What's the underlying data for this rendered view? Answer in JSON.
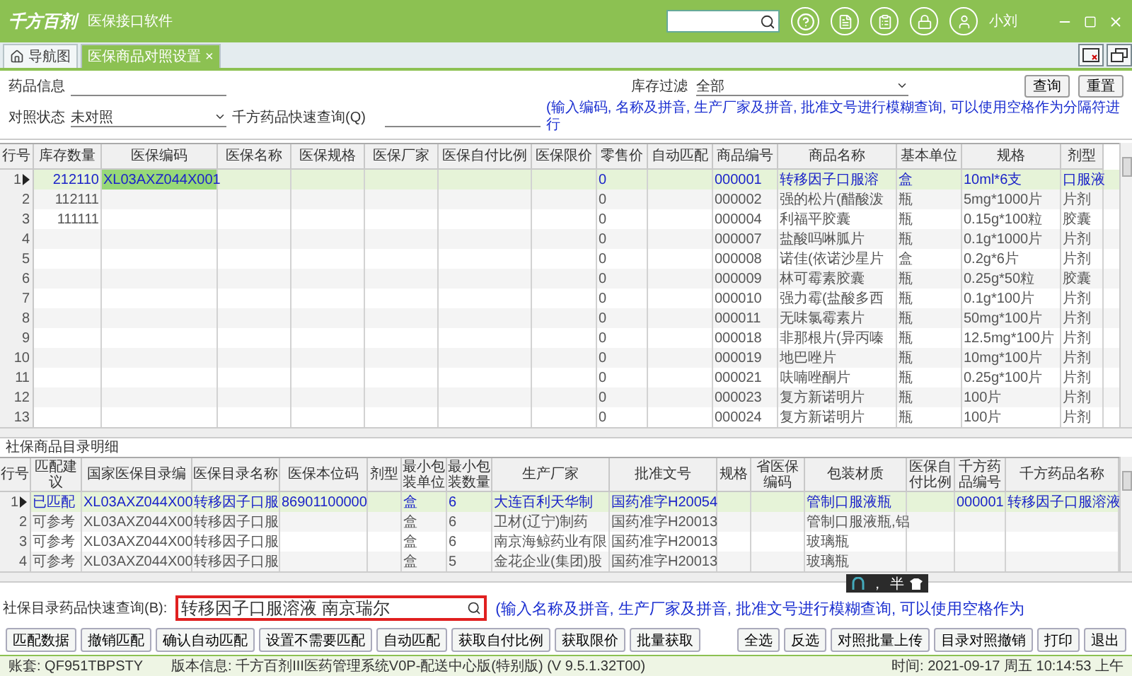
{
  "app": {
    "logo": "千方百剂",
    "title": "医保接口软件",
    "user": "小刘"
  },
  "tabs": [
    {
      "label": "导航图",
      "selected": false,
      "home": true
    },
    {
      "label": "医保商品对照设置",
      "selected": true,
      "close": "×"
    }
  ],
  "filters": {
    "drug_info": {
      "label": "药品信息"
    },
    "match_status": {
      "label": "对照状态",
      "value": "未对照"
    },
    "quick_query": {
      "label": "千方药品快速查询(Q)"
    },
    "stock_filter": {
      "label": "库存过滤",
      "value": "全部"
    },
    "buttons": [
      "查询",
      "重置"
    ],
    "hint": "(输入编码, 名称及拼音, 生产厂家及拼音, 批准文号进行模糊查询, 可以使用空格作为分隔符进行"
  },
  "goods_table": {
    "columns": [
      "行号",
      "库存数量",
      "医保编码",
      "医保名称",
      "医保规格",
      "医保厂家",
      "医保自付比例",
      "医保限价",
      "零售价",
      "自动匹配",
      "商品编号",
      "商品名称",
      "基本单位",
      "规格",
      "剂型"
    ],
    "rows": [
      {
        "selected": true,
        "cells": [
          "1",
          "212110",
          {
            "text": "XL03AXZ044X001",
            "active": true
          },
          "",
          "",
          "",
          "",
          "",
          "0",
          "",
          "000001",
          "转移因子口服溶",
          "盒",
          "10ml*6支",
          "口服液"
        ]
      },
      {
        "selected": false,
        "cells": [
          "2",
          "112111",
          "",
          "",
          "",
          "",
          "",
          "",
          "0",
          "",
          "000002",
          "强的松片(醋酸泼",
          "瓶",
          "5mg*1000片",
          "片剂"
        ]
      },
      {
        "selected": false,
        "cells": [
          "3",
          "111111",
          "",
          "",
          "",
          "",
          "",
          "",
          "0",
          "",
          "000004",
          "利福平胶囊",
          "瓶",
          "0.15g*100粒",
          "胶囊"
        ]
      },
      {
        "selected": false,
        "cells": [
          "4",
          "",
          "",
          "",
          "",
          "",
          "",
          "",
          "0",
          "",
          "000007",
          "盐酸吗啉胍片",
          "瓶",
          "0.1g*1000片",
          "片剂"
        ]
      },
      {
        "selected": false,
        "cells": [
          "5",
          "",
          "",
          "",
          "",
          "",
          "",
          "",
          "0",
          "",
          "000008",
          "诺佳(依诺沙星片",
          "盒",
          "0.2g*6片",
          "片剂"
        ]
      },
      {
        "selected": false,
        "cells": [
          "6",
          "",
          "",
          "",
          "",
          "",
          "",
          "",
          "0",
          "",
          "000009",
          "林可霉素胶囊",
          "瓶",
          "0.25g*50粒",
          "胶囊"
        ]
      },
      {
        "selected": false,
        "cells": [
          "7",
          "",
          "",
          "",
          "",
          "",
          "",
          "",
          "0",
          "",
          "000010",
          "强力霉(盐酸多西",
          "瓶",
          "0.1g*100片",
          "片剂"
        ]
      },
      {
        "selected": false,
        "cells": [
          "8",
          "",
          "",
          "",
          "",
          "",
          "",
          "",
          "0",
          "",
          "000011",
          "无味氯霉素片",
          "瓶",
          "50mg*100片",
          "片剂"
        ]
      },
      {
        "selected": false,
        "cells": [
          "9",
          "",
          "",
          "",
          "",
          "",
          "",
          "",
          "0",
          "",
          "000018",
          "非那根片(异丙嗪",
          "瓶",
          "12.5mg*100片",
          "片剂"
        ]
      },
      {
        "selected": false,
        "cells": [
          "10",
          "",
          "",
          "",
          "",
          "",
          "",
          "",
          "0",
          "",
          "000019",
          "地巴唑片",
          "瓶",
          "10mg*100片",
          "片剂"
        ]
      },
      {
        "selected": false,
        "cells": [
          "11",
          "",
          "",
          "",
          "",
          "",
          "",
          "",
          "0",
          "",
          "000021",
          "呋喃唑酮片",
          "瓶",
          "0.25g*100片",
          "片剂"
        ]
      },
      {
        "selected": false,
        "cells": [
          "12",
          "",
          "",
          "",
          "",
          "",
          "",
          "",
          "0",
          "",
          "000023",
          "复方新诺明片",
          "瓶",
          "100片",
          "片剂"
        ]
      },
      {
        "selected": false,
        "cells": [
          "13",
          "",
          "",
          "",
          "",
          "",
          "",
          "",
          "0",
          "",
          "000024",
          "复方新诺明片",
          "瓶",
          "100片",
          "片剂"
        ]
      }
    ]
  },
  "catalog_section": {
    "title": "社保商品目录明细",
    "columns": [
      "行号",
      "匹配建议",
      "国家医保目录编",
      "医保目录名称",
      "医保本位码",
      "剂型",
      "最小包装单位",
      "最小包装数量",
      "生产厂家",
      "批准文号",
      "规格",
      "省医保编码",
      "包装材质",
      "医保自付比例",
      "千方药品编号",
      "千方药品名称"
    ],
    "rows": [
      {
        "selected": true,
        "cells": [
          "1",
          "已匹配",
          "XL03AXZ044X00",
          "转移因子口服",
          "86901100000",
          "",
          "盒",
          "6",
          "大连百利天华制",
          "国药准字H20054",
          "",
          "",
          "管制口服液瓶",
          "",
          "000001",
          "转移因子口服溶液"
        ]
      },
      {
        "selected": false,
        "cells": [
          "2",
          "可参考",
          "XL03AXZ044X00",
          "转移因子口服",
          "",
          "",
          "盒",
          "6",
          "卫材(辽宁)制药",
          "国药准字H20013",
          "",
          "",
          "管制口服液瓶,铝",
          "",
          "",
          ""
        ]
      },
      {
        "selected": false,
        "cells": [
          "3",
          "可参考",
          "XL03AXZ044X00",
          "转移因子口服",
          "",
          "",
          "盒",
          "6",
          "南京海鲸药业有限",
          "国药准字H20013",
          "",
          "",
          "玻璃瓶",
          "",
          "",
          ""
        ]
      },
      {
        "selected": false,
        "cells": [
          "4",
          "可参考",
          "XL03AXZ044X00",
          "转移因子口服",
          "",
          "",
          "盒",
          "5",
          "金花企业(集团)股",
          "国药准字H20013",
          "",
          "",
          "玻璃瓶",
          "",
          "",
          ""
        ]
      }
    ]
  },
  "catalog_query": {
    "label": "社保目录药品快速查询(B):",
    "value": "转移因子口服溶液  南京瑞尔",
    "hint": "(输入名称及拼音, 生产厂家及拼音, 批准文号进行模糊查询, 可以使用空格作为"
  },
  "ime_bar": {
    "punctuation": "，",
    "width": "半"
  },
  "buttons_left": [
    "匹配数据",
    "撤销匹配",
    "确认自动匹配",
    "设置不需要匹配",
    "自动匹配",
    "获取自付比例",
    "获取限价",
    "批量获取"
  ],
  "buttons_right": [
    "全选",
    "反选",
    "对照批量上传",
    "目录对照撤销",
    "打印",
    "退出"
  ],
  "status_bar": {
    "account": "账套: QF951TBPSTY",
    "version": "版本信息: 千方百剂III医药管理系统V0P-配送中心版(特别版) (V 9.5.1.32T00)",
    "time": "时间: 2021-09-17 周五 10:14:53 上午"
  }
}
